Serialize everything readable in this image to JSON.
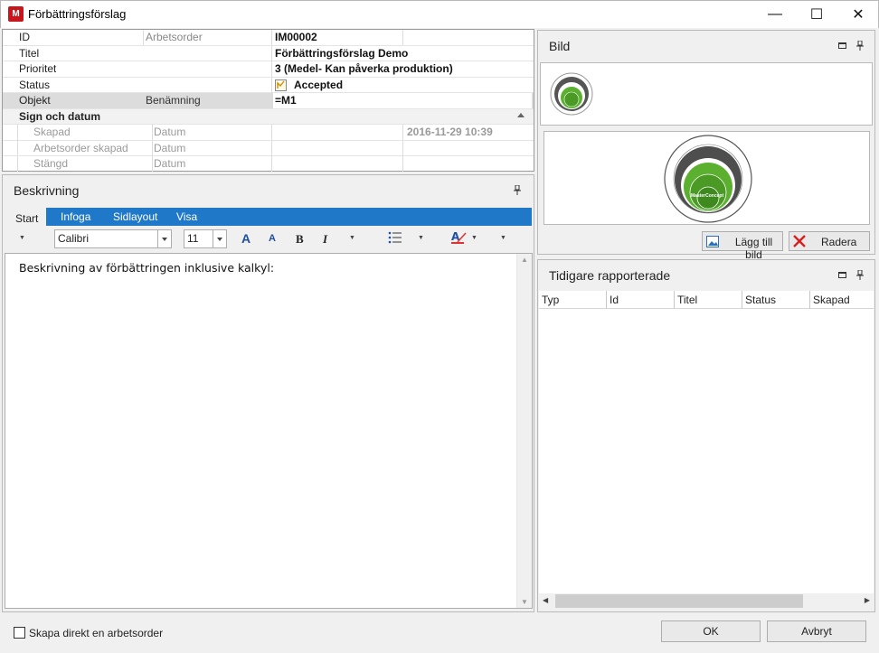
{
  "window": {
    "title": "Förbättringsförslag",
    "app_icon": "M",
    "controls": {
      "minimize": "—",
      "maximize": "☐",
      "close": "✕"
    }
  },
  "properties": {
    "rows": [
      {
        "label": "ID",
        "sub": "Arbetsorder",
        "value": "IM00002"
      },
      {
        "label": "Titel",
        "sub": "",
        "value": "Förbättringsförslag Demo"
      },
      {
        "label": "Prioritet",
        "sub": "",
        "value": "3 (Medel- Kan påverka produktion)"
      },
      {
        "label": "Status",
        "sub": "",
        "value": "Accepted"
      },
      {
        "label": "Objekt",
        "sub": "Benämning",
        "value": "=M1"
      }
    ],
    "section": {
      "title": "Sign och datum",
      "rows": [
        {
          "label": "Skapad",
          "sub": "Datum",
          "value": "2016-11-29 10:39"
        },
        {
          "label": "Arbetsorder skapad",
          "sub": "Datum",
          "value": ""
        },
        {
          "label": "Stängd",
          "sub": "Datum",
          "value": ""
        }
      ]
    }
  },
  "description": {
    "title": "Beskrivning",
    "tabs": [
      "Start",
      "Infoga",
      "Sidlayout",
      "Visa"
    ],
    "font": "Calibri",
    "font_size": "11",
    "toolbar": {
      "bold": "B",
      "italic": "I",
      "grow": "A",
      "shrink": "A"
    },
    "text": "Beskrivning av förbättringen inklusive kalkyl:"
  },
  "image_panel": {
    "title": "Bild",
    "add_button": "Lägg till bild",
    "delete_button": "Radera",
    "logo_label": "MasterConcept"
  },
  "history_panel": {
    "title": "Tidigare rapporterade",
    "columns": [
      "Typ",
      "Id",
      "Titel",
      "Status",
      "Skapad"
    ],
    "rows": []
  },
  "footer": {
    "checkbox_label": "Skapa direkt en arbetsorder",
    "checkbox_checked": false,
    "ok_button": "OK",
    "cancel_button": "Avbryt"
  },
  "colors": {
    "ribbon": "#1f78c8",
    "accent_green": "#5cb030",
    "brand_red": "#c8161d"
  }
}
